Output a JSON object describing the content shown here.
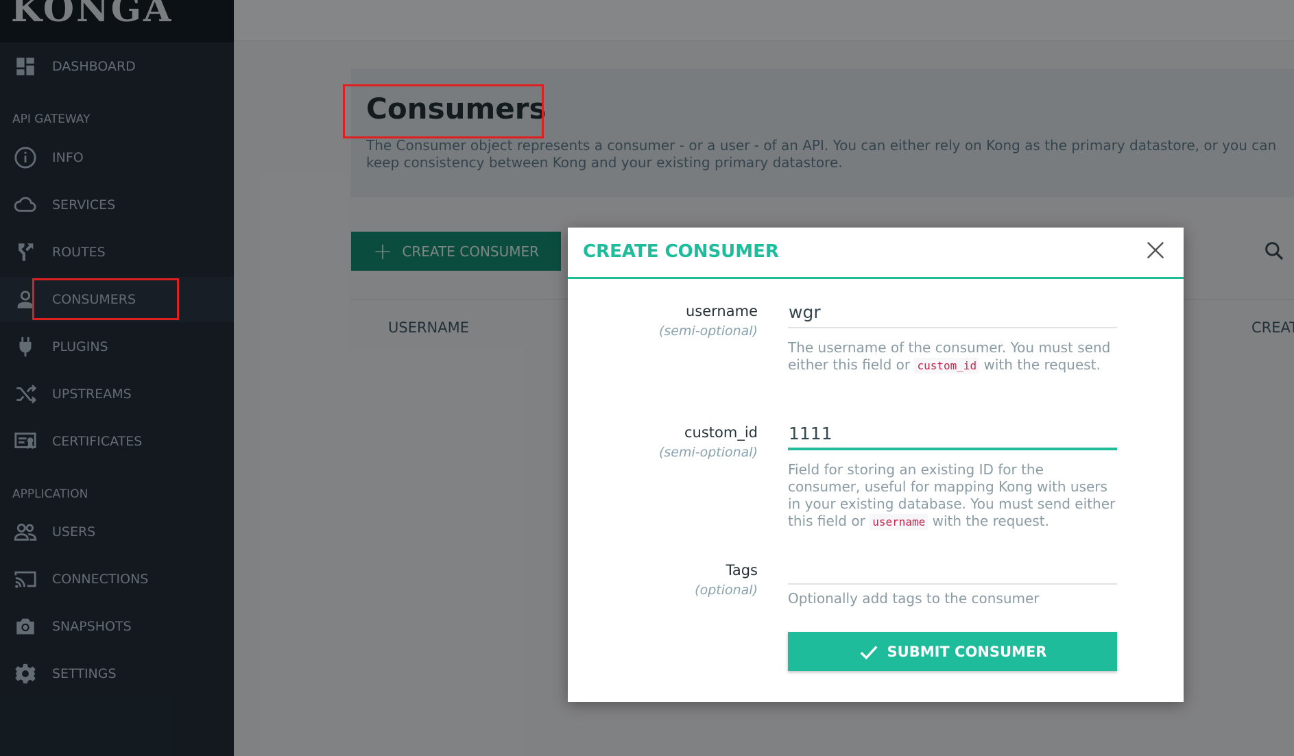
{
  "app": {
    "logo": "KONGA"
  },
  "sidebar": {
    "dashboard": "DASHBOARD",
    "section_api": "API GATEWAY",
    "info": "INFO",
    "services": "SERVICES",
    "routes": "ROUTES",
    "consumers": "CONSUMERS",
    "plugins": "PLUGINS",
    "upstreams": "UPSTREAMS",
    "certificates": "CERTIFICATES",
    "section_app": "APPLICATION",
    "users": "USERS",
    "connections": "CONNECTIONS",
    "snapshots": "SNAPSHOTS",
    "settings": "SETTINGS",
    "active_item": "CONSUMERS"
  },
  "main": {
    "title": "Consumers",
    "description_line1": "The Consumer object represents a consumer - or a user - of an API. You can either rely on Kong as the primary datastore, or you can",
    "description_line2": "keep consistency between Kong and your existing primary datastore.",
    "create_button": "CREATE CONSUMER",
    "columns": {
      "username": "USERNAME",
      "created": "CREATED"
    }
  },
  "modal": {
    "title": "CREATE CONSUMER",
    "fields": {
      "username": {
        "label": "username",
        "sub": "(semi-optional)",
        "value": "wgr",
        "help_a": "The username of the consumer. You must send either this field or ",
        "help_code": "custom_id",
        "help_b": " with the request."
      },
      "custom_id": {
        "label": "custom_id",
        "sub": "(semi-optional)",
        "value": "1111",
        "help_a": "Field for storing an existing ID for the consumer, useful for mapping Kong with users in your existing database. You must send either this field or ",
        "help_code": "username",
        "help_b": " with the request."
      },
      "tags": {
        "label": "Tags",
        "sub": "(optional)",
        "value": "",
        "help": "Optionally add tags to the consumer"
      }
    },
    "submit": "SUBMIT CONSUMER"
  },
  "colors": {
    "accent": "#1fbc9c",
    "sidebar_bg": "#232f3a",
    "primary_button": "#138c73",
    "annotation": "#e02020"
  }
}
